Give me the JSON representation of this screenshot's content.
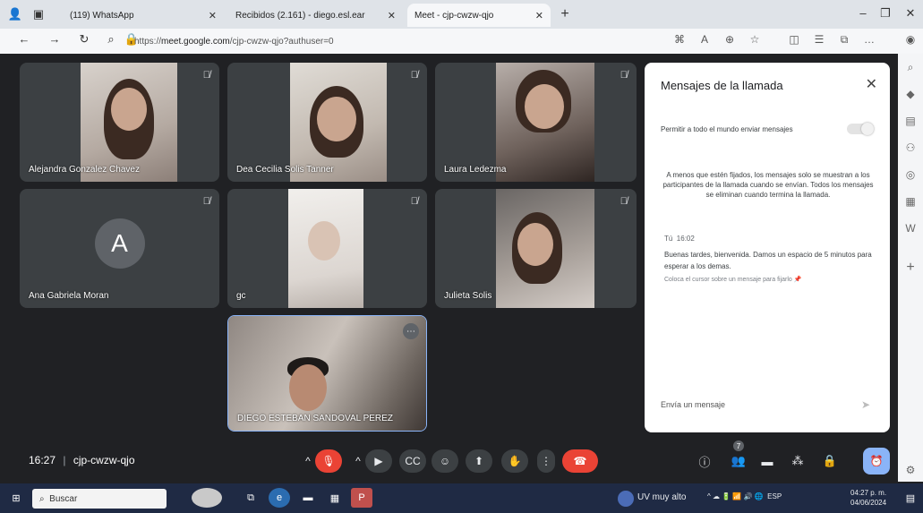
{
  "browser": {
    "tabs": [
      {
        "label": "(119) WhatsApp"
      },
      {
        "label": "Recibidos (2.161) - diego.esl.ear"
      },
      {
        "label": "Meet - cjp-cwzw-qjo"
      }
    ],
    "url_prefix": "https://",
    "url_domain": "meet.google.com",
    "url_path": "/cjp-cwzw-qjo?authuser=0"
  },
  "meet": {
    "participants": [
      {
        "name": "Alejandra Gonzalez Chavez"
      },
      {
        "name": "Dea Cecilia Solis Tanner"
      },
      {
        "name": "Laura Ledezma"
      },
      {
        "name": "Ana Gabriela Moran",
        "initial": "A"
      },
      {
        "name": "gc"
      },
      {
        "name": "Julieta Solis"
      },
      {
        "name": "DIEGO ESTEBAN SANDOVAL PEREZ"
      }
    ],
    "time": "16:27",
    "separator": "|",
    "meeting_code": "cjp-cwzw-qjo",
    "people_count": "7"
  },
  "chat": {
    "title": "Mensajes de la llamada",
    "allow_label": "Permitir a todo el mundo enviar mensajes",
    "notice": "A menos que estén fijados, los mensajes solo se muestran a los participantes de la llamada cuando se envían. Todos los mensajes se eliminan cuando termina la llamada.",
    "sender": "Tú",
    "sent_time": "16:02",
    "message": "Buenas tardes, bienvenida. Damos un espacio de 5 minutos para esperar a los demas.",
    "hint": "Coloca el cursor sobre un mensaje para fijarlo",
    "input_placeholder": "Envía un mensaje"
  },
  "taskbar": {
    "search_label": "Buscar",
    "weather": "UV muy alto",
    "lang": "ESP",
    "time": "04:27 p. m.",
    "date": "04/06/2024"
  }
}
